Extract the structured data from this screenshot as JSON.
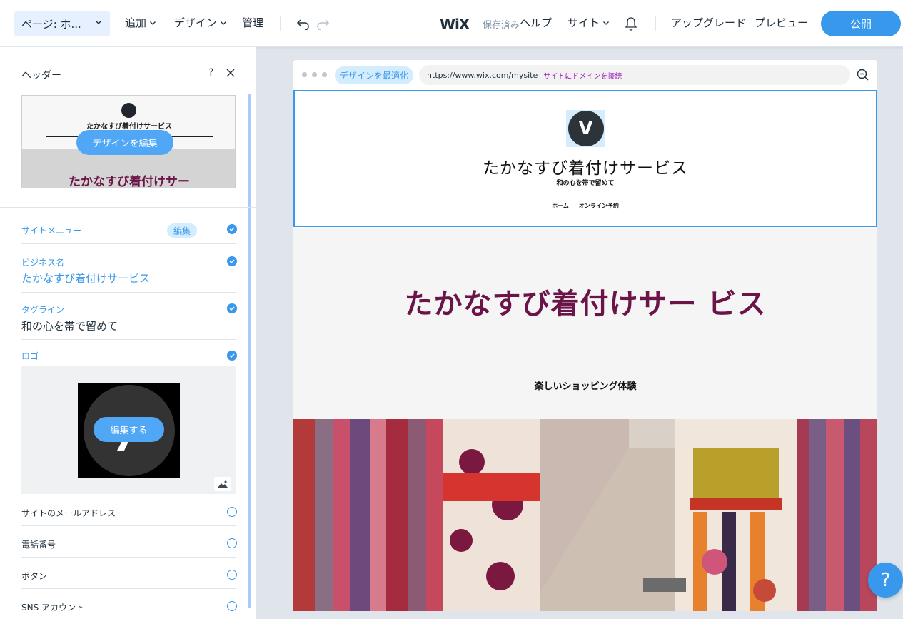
{
  "topbar": {
    "page_select": "ページ: ホ...",
    "menu": {
      "add": "追加",
      "design": "デザイン",
      "manage": "管理"
    },
    "brand": "WiX",
    "saved": "保存済み",
    "help": "ヘルプ",
    "site": "サイト",
    "upgrade": "アップグレード",
    "preview": "プレビュー",
    "publish": "公開"
  },
  "panel": {
    "title": "ヘッダー",
    "help": "?",
    "preview": {
      "name_small": "たかなすび着付けサービス",
      "name_big": "たかなすび着付けサー",
      "edit_design": "デザインを編集"
    },
    "rows": {
      "site_menu": {
        "label": "サイトメニュー",
        "badge": "編集"
      },
      "business_name": {
        "label": "ビジネス名",
        "value": "たかなすび着付けサービス"
      },
      "tagline": {
        "label": "タグライン",
        "value": "和の心を帯で留めて"
      },
      "logo": {
        "label": "ロゴ",
        "edit": "編集する"
      },
      "email": {
        "label": "サイトのメールアドレス"
      },
      "phone": {
        "label": "電話番号"
      },
      "button": {
        "label": "ボタン"
      },
      "sns": {
        "label": "SNS アカウント"
      }
    }
  },
  "browser": {
    "optimize": "デザインを最適化",
    "url": "https://www.wix.com/mysite",
    "connect_domain": "サイトにドメインを接続"
  },
  "site": {
    "logo_letter": "V",
    "name": "たかなすび着付けサービス",
    "tagline": "和の心を帯で留めて",
    "nav": [
      "ホーム",
      "オンライン予約"
    ],
    "hero_title": "たかなすび着付けサー ビス",
    "hero_sub": "楽しいショッピング体験"
  },
  "fab": {
    "help": "?"
  },
  "colors": {
    "accent": "#3899ec",
    "brand_title": "#6a1447",
    "light_accent": "#d3ecfe"
  }
}
